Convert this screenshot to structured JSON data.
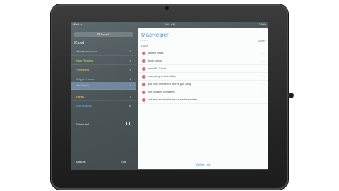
{
  "statusbar": {
    "carrier": "iPad ✦",
    "time": "9:41 AM",
    "battery": "100%"
  },
  "sidebar": {
    "search_label": "Search",
    "section_title": "iCloud",
    "lists": [
      {
        "name": "Miscellaneous list",
        "count": "0",
        "color": "#c9d3d6"
      },
      {
        "name": "Book Reading",
        "count": "4",
        "color": "#b8e36b"
      },
      {
        "name": "Reminders",
        "count": "0",
        "color": "#e6c34a"
      },
      {
        "name": "Chipper House",
        "count": "0",
        "color": "#8fd0ef"
      },
      {
        "name": "MacHelper",
        "count": "9",
        "color": "#9fc6ff"
      },
      {
        "name": "Things",
        "count": "4",
        "color": "#f0cf58"
      },
      {
        "name": "Just Errands",
        "count": "11",
        "color": "#62b3ec"
      }
    ],
    "scheduled_label": "Scheduled",
    "add_list_label": "Add List",
    "edit_label": "Edit"
  },
  "panel": {
    "title": "MacHelper",
    "subtitle": "9 items",
    "done_label": "Done",
    "section_label": "Done",
    "tasks": [
      "add for install",
      "blurb upload",
      "new iOS 7 book",
      "mail stamp to both sides",
      "put book on internet as free give away",
      "get websites completed",
      "ask amy about sales tax for macheatsheets"
    ],
    "task_more": "—",
    "delete_label": "Delete List"
  },
  "colors": {
    "accent": "#4a90c8",
    "task_dot": "#e06a78",
    "selected_row": "#91afd7"
  }
}
